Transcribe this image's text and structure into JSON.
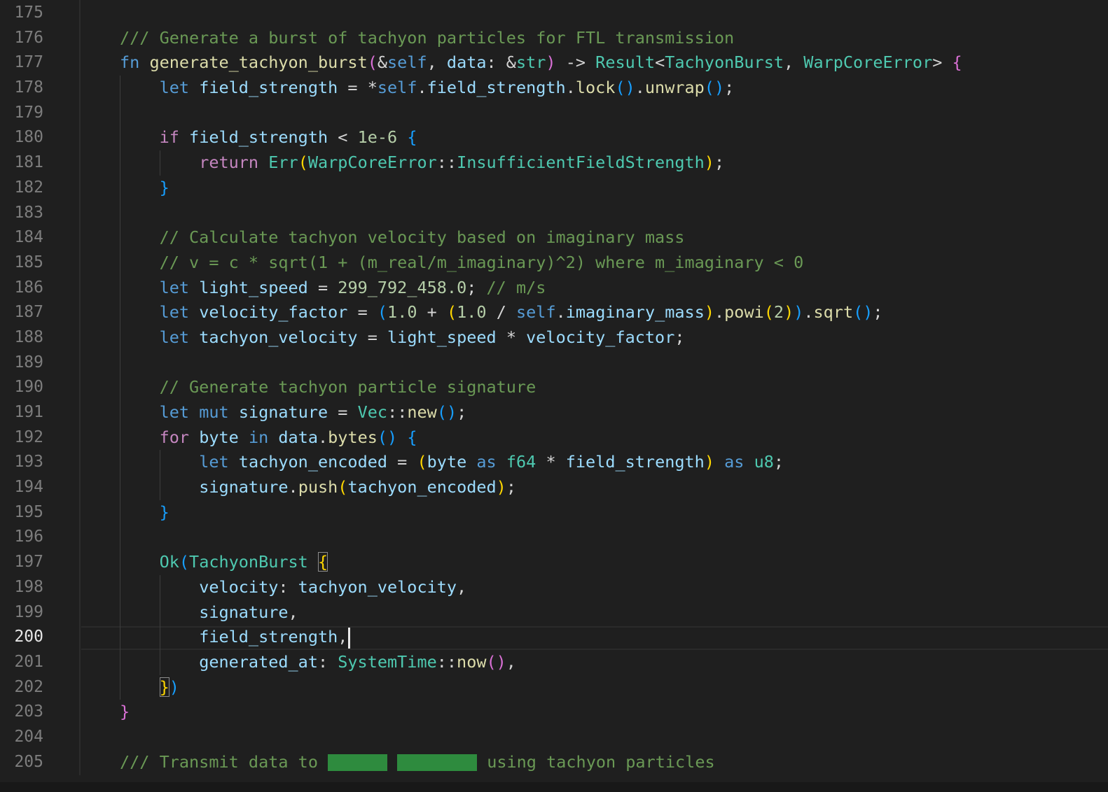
{
  "editor": {
    "language": "rust",
    "active_line": "200",
    "lines": [
      {
        "n": "175",
        "s": []
      },
      {
        "n": "176",
        "s": [
          [
            "cm",
            "/// Generate a burst of tachyon particles for FTL transmission"
          ]
        ]
      },
      {
        "n": "177",
        "s": [
          [
            "kw",
            "fn"
          ],
          [
            "op",
            " "
          ],
          [
            "fn",
            "generate_tachyon_burst"
          ],
          [
            "p2",
            "("
          ],
          [
            "op",
            "&"
          ],
          [
            "kw",
            "self"
          ],
          [
            "op",
            ", "
          ],
          [
            "var",
            "data"
          ],
          [
            "op",
            ": &"
          ],
          [
            "ty",
            "str"
          ],
          [
            "p2",
            ")"
          ],
          [
            "op",
            " -> "
          ],
          [
            "ty",
            "Result"
          ],
          [
            "op",
            "<"
          ],
          [
            "ty",
            "TachyonBurst"
          ],
          [
            "op",
            ", "
          ],
          [
            "ty",
            "WarpCoreError"
          ],
          [
            "op",
            "> "
          ],
          [
            "p2",
            "{"
          ]
        ]
      },
      {
        "n": "178",
        "s": [
          [
            "op",
            "    "
          ],
          [
            "kw",
            "let"
          ],
          [
            "op",
            " "
          ],
          [
            "var",
            "field_strength"
          ],
          [
            "op",
            " = *"
          ],
          [
            "kw",
            "self"
          ],
          [
            "op",
            "."
          ],
          [
            "var",
            "field_strength"
          ],
          [
            "op",
            "."
          ],
          [
            "fn",
            "lock"
          ],
          [
            "p3",
            "()"
          ],
          [
            "op",
            "."
          ],
          [
            "fn",
            "unwrap"
          ],
          [
            "p3",
            "()"
          ],
          [
            "op",
            ";"
          ]
        ]
      },
      {
        "n": "179",
        "s": []
      },
      {
        "n": "180",
        "s": [
          [
            "op",
            "    "
          ],
          [
            "ctl",
            "if"
          ],
          [
            "op",
            " "
          ],
          [
            "var",
            "field_strength"
          ],
          [
            "op",
            " < "
          ],
          [
            "num",
            "1e-6"
          ],
          [
            "op",
            " "
          ],
          [
            "p3",
            "{"
          ]
        ]
      },
      {
        "n": "181",
        "s": [
          [
            "op",
            "        "
          ],
          [
            "ctl",
            "return"
          ],
          [
            "op",
            " "
          ],
          [
            "ty",
            "Err"
          ],
          [
            "p1",
            "("
          ],
          [
            "ty",
            "WarpCoreError"
          ],
          [
            "op",
            "::"
          ],
          [
            "ty",
            "InsufficientFieldStrength"
          ],
          [
            "p1",
            ")"
          ],
          [
            "op",
            ";"
          ]
        ]
      },
      {
        "n": "182",
        "s": [
          [
            "op",
            "    "
          ],
          [
            "p3",
            "}"
          ]
        ]
      },
      {
        "n": "183",
        "s": []
      },
      {
        "n": "184",
        "s": [
          [
            "op",
            "    "
          ],
          [
            "cm",
            "// Calculate tachyon velocity based on imaginary mass"
          ]
        ]
      },
      {
        "n": "185",
        "s": [
          [
            "op",
            "    "
          ],
          [
            "cm",
            "// v = c * sqrt(1 + (m_real/m_imaginary)^2) where m_imaginary < 0"
          ]
        ]
      },
      {
        "n": "186",
        "s": [
          [
            "op",
            "    "
          ],
          [
            "kw",
            "let"
          ],
          [
            "op",
            " "
          ],
          [
            "var",
            "light_speed"
          ],
          [
            "op",
            " = "
          ],
          [
            "num",
            "299_792_458.0"
          ],
          [
            "op",
            "; "
          ],
          [
            "cm",
            "// m/s"
          ]
        ]
      },
      {
        "n": "187",
        "s": [
          [
            "op",
            "    "
          ],
          [
            "kw",
            "let"
          ],
          [
            "op",
            " "
          ],
          [
            "var",
            "velocity_factor"
          ],
          [
            "op",
            " = "
          ],
          [
            "p3",
            "("
          ],
          [
            "num",
            "1.0"
          ],
          [
            "op",
            " + "
          ],
          [
            "p1",
            "("
          ],
          [
            "num",
            "1.0"
          ],
          [
            "op",
            " / "
          ],
          [
            "kw",
            "self"
          ],
          [
            "op",
            "."
          ],
          [
            "var",
            "imaginary_mass"
          ],
          [
            "p1",
            ")"
          ],
          [
            "op",
            "."
          ],
          [
            "fn",
            "powi"
          ],
          [
            "p1",
            "("
          ],
          [
            "num",
            "2"
          ],
          [
            "p1",
            ")"
          ],
          [
            "p3",
            ")"
          ],
          [
            "op",
            "."
          ],
          [
            "fn",
            "sqrt"
          ],
          [
            "p3",
            "()"
          ],
          [
            "op",
            ";"
          ]
        ]
      },
      {
        "n": "188",
        "s": [
          [
            "op",
            "    "
          ],
          [
            "kw",
            "let"
          ],
          [
            "op",
            " "
          ],
          [
            "var",
            "tachyon_velocity"
          ],
          [
            "op",
            " = "
          ],
          [
            "var",
            "light_speed"
          ],
          [
            "op",
            " * "
          ],
          [
            "var",
            "velocity_factor"
          ],
          [
            "op",
            ";"
          ]
        ]
      },
      {
        "n": "189",
        "s": []
      },
      {
        "n": "190",
        "s": [
          [
            "op",
            "    "
          ],
          [
            "cm",
            "// Generate tachyon particle signature"
          ]
        ]
      },
      {
        "n": "191",
        "s": [
          [
            "op",
            "    "
          ],
          [
            "kw",
            "let"
          ],
          [
            "op",
            " "
          ],
          [
            "kw",
            "mut"
          ],
          [
            "op",
            " "
          ],
          [
            "var",
            "signature"
          ],
          [
            "op",
            " = "
          ],
          [
            "ty",
            "Vec"
          ],
          [
            "op",
            "::"
          ],
          [
            "fn",
            "new"
          ],
          [
            "p3",
            "()"
          ],
          [
            "op",
            ";"
          ]
        ]
      },
      {
        "n": "192",
        "s": [
          [
            "op",
            "    "
          ],
          [
            "ctl",
            "for"
          ],
          [
            "op",
            " "
          ],
          [
            "var",
            "byte"
          ],
          [
            "op",
            " "
          ],
          [
            "kw",
            "in"
          ],
          [
            "op",
            " "
          ],
          [
            "var",
            "data"
          ],
          [
            "op",
            "."
          ],
          [
            "fn",
            "bytes"
          ],
          [
            "p3",
            "()"
          ],
          [
            "op",
            " "
          ],
          [
            "p3",
            "{"
          ]
        ]
      },
      {
        "n": "193",
        "s": [
          [
            "op",
            "        "
          ],
          [
            "kw",
            "let"
          ],
          [
            "op",
            " "
          ],
          [
            "var",
            "tachyon_encoded"
          ],
          [
            "op",
            " = "
          ],
          [
            "p1",
            "("
          ],
          [
            "var",
            "byte"
          ],
          [
            "op",
            " "
          ],
          [
            "kw",
            "as"
          ],
          [
            "op",
            " "
          ],
          [
            "ty",
            "f64"
          ],
          [
            "op",
            " * "
          ],
          [
            "var",
            "field_strength"
          ],
          [
            "p1",
            ")"
          ],
          [
            "op",
            " "
          ],
          [
            "kw",
            "as"
          ],
          [
            "op",
            " "
          ],
          [
            "ty",
            "u8"
          ],
          [
            "op",
            ";"
          ]
        ]
      },
      {
        "n": "194",
        "s": [
          [
            "op",
            "        "
          ],
          [
            "var",
            "signature"
          ],
          [
            "op",
            "."
          ],
          [
            "fn",
            "push"
          ],
          [
            "p1",
            "("
          ],
          [
            "var",
            "tachyon_encoded"
          ],
          [
            "p1",
            ")"
          ],
          [
            "op",
            ";"
          ]
        ]
      },
      {
        "n": "195",
        "s": [
          [
            "op",
            "    "
          ],
          [
            "p3",
            "}"
          ]
        ]
      },
      {
        "n": "196",
        "s": []
      },
      {
        "n": "197",
        "s": [
          [
            "op",
            "    "
          ],
          [
            "ty",
            "Ok"
          ],
          [
            "p3",
            "("
          ],
          [
            "ty",
            "TachyonBurst"
          ],
          [
            "op",
            " "
          ],
          [
            "p1m",
            "{"
          ]
        ]
      },
      {
        "n": "198",
        "s": [
          [
            "op",
            "        "
          ],
          [
            "var",
            "velocity"
          ],
          [
            "op",
            ": "
          ],
          [
            "var",
            "tachyon_velocity"
          ],
          [
            "op",
            ","
          ]
        ]
      },
      {
        "n": "199",
        "s": [
          [
            "op",
            "        "
          ],
          [
            "var",
            "signature"
          ],
          [
            "op",
            ","
          ]
        ]
      },
      {
        "n": "200",
        "s": [
          [
            "op",
            "        "
          ],
          [
            "var",
            "field_strength"
          ],
          [
            "op",
            ","
          ],
          [
            "cursor",
            ""
          ]
        ]
      },
      {
        "n": "201",
        "s": [
          [
            "op",
            "        "
          ],
          [
            "var",
            "generated_at"
          ],
          [
            "op",
            ": "
          ],
          [
            "ty",
            "SystemTime"
          ],
          [
            "op",
            "::"
          ],
          [
            "fn",
            "now"
          ],
          [
            "p2",
            "()"
          ],
          [
            "op",
            ","
          ]
        ]
      },
      {
        "n": "202",
        "s": [
          [
            "op",
            "    "
          ],
          [
            "p1m",
            "}"
          ],
          [
            "p3",
            ")"
          ]
        ]
      },
      {
        "n": "203",
        "s": [
          [
            "p2",
            "}"
          ]
        ]
      },
      {
        "n": "204",
        "s": []
      },
      {
        "n": "205",
        "s": [
          [
            "cm",
            "/// Transmit data to "
          ],
          [
            "redact",
            "6"
          ],
          [
            "op",
            " "
          ],
          [
            "redact",
            "8"
          ],
          [
            "cm",
            " using tachyon particles"
          ]
        ]
      }
    ]
  }
}
